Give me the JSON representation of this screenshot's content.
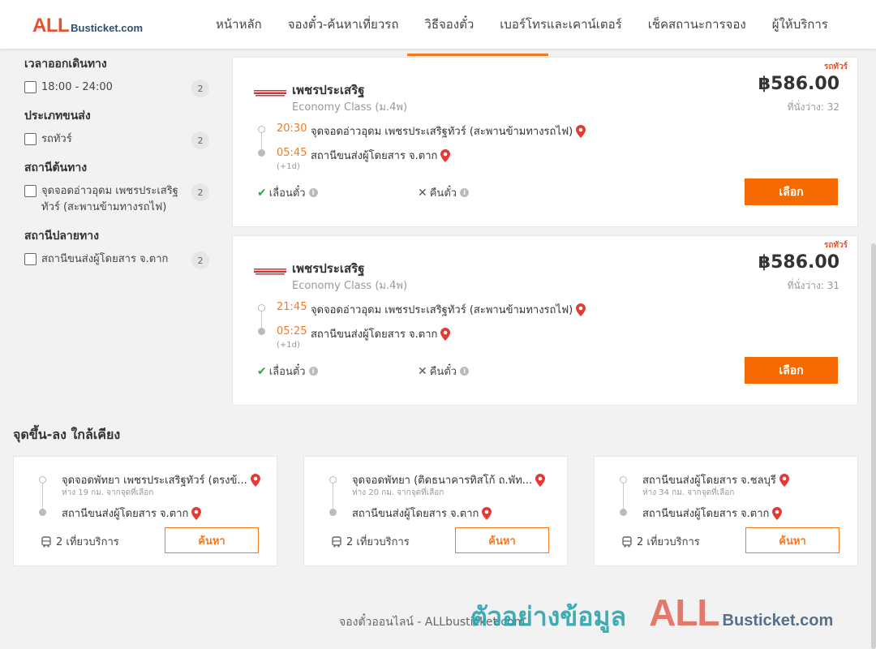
{
  "header": {
    "logo_all": "ALL",
    "logo_rest": "Busticket.com",
    "nav": [
      "หน้าหลัก",
      "จองตั๋ว-ค้นหาเที่ยวรถ",
      "วิธีจองตั๋ว",
      "เบอร์โทรและเคาน์เตอร์",
      "เช็คสถานะการจอง",
      "ผู้ให้บริการ"
    ]
  },
  "filters": [
    {
      "title": "เวลาออกเดินทาง",
      "options": [
        {
          "label": "18:00 - 24:00",
          "count": "2"
        }
      ]
    },
    {
      "title": "ประเภทขนส่ง",
      "options": [
        {
          "label": "รถทัวร์",
          "count": "2"
        }
      ]
    },
    {
      "title": "สถานีต้นทาง",
      "options": [
        {
          "label": "จุดจอดอ่าวอุดม เพชรประเสริฐทัวร์ (สะพานข้ามทางรถไฟ)",
          "count": "2"
        }
      ]
    },
    {
      "title": "สถานีปลายทาง",
      "options": [
        {
          "label": "สถานีขนส่งผู้โดยสาร จ.ตาก",
          "count": "2"
        }
      ]
    }
  ],
  "trips": [
    {
      "tag": "รถทัวร์",
      "operator": "เพชรประเสริฐ",
      "class": "Economy Class (ม.4พ)",
      "price": "฿586.00",
      "seats": "ที่นั่งว่าง: 32",
      "depart_time": "20:30",
      "depart_stop": "จุดจอดอ่าวอุดม เพชรประเสริฐทัวร์ (สะพานข้ามทางรถไฟ)",
      "arrive_time": "05:45",
      "arrive_stop": "สถานีขนส่งผู้โดยสาร จ.ตาก",
      "plus_day": "(+1d)",
      "feature_postpone": "เลื่อนตั๋ว",
      "feature_refund": "คืนตั๋ว",
      "select_label": "เลือก"
    },
    {
      "tag": "รถทัวร์",
      "operator": "เพชรประเสริฐ",
      "class": "Economy Class (ม.4พ)",
      "price": "฿586.00",
      "seats": "ที่นั่งว่าง: 31",
      "depart_time": "21:45",
      "depart_stop": "จุดจอดอ่าวอุดม เพชรประเสริฐทัวร์ (สะพานข้ามทางรถไฟ)",
      "arrive_time": "05:25",
      "arrive_stop": "สถานีขนส่งผู้โดยสาร จ.ตาก",
      "plus_day": "(+1d)",
      "feature_postpone": "เลื่อนตั๋ว",
      "feature_refund": "คืนตั๋ว",
      "select_label": "เลือก"
    }
  ],
  "nearby": {
    "title": "จุดขึ้น-ลง ใกล้เคียง",
    "items": [
      {
        "from": "จุดจอดพัทยา เพชรประเสริฐทัวร์ (ตรงข้...",
        "distance": "ห่าง 19 กม. จากจุดที่เลือก",
        "to": "สถานีขนส่งผู้โดยสาร จ.ตาก",
        "trips": "2 เที่ยวบริการ",
        "search_label": "ค้นหา"
      },
      {
        "from": "จุดจอดพัทยา (ติดธนาคารทิสโก้ ถ.พัท...",
        "distance": "ห่าง 20 กม. จากจุดที่เลือก",
        "to": "สถานีขนส่งผู้โดยสาร จ.ตาก",
        "trips": "2 เที่ยวบริการ",
        "search_label": "ค้นหา"
      },
      {
        "from": "สถานีขนส่งผู้โดยสาร จ.ชลบุรี",
        "distance": "ห่าง 34 กม. จากจุดที่เลือก",
        "to": "สถานีขนส่งผู้โดยสาร จ.ตาก",
        "trips": "2 เที่ยวบริการ",
        "search_label": "ค้นหา"
      }
    ]
  },
  "footer": {
    "text": "จองตั๋วออนไลน์ - ALLbusticket.com"
  },
  "watermark": {
    "text": "ตัวอย่างข้อมูล",
    "all": "ALL",
    "rest": "Busticket.com"
  },
  "colors": {
    "accent": "#f56a00",
    "brand_red": "#e8502d",
    "pin_red": "#e53935"
  }
}
